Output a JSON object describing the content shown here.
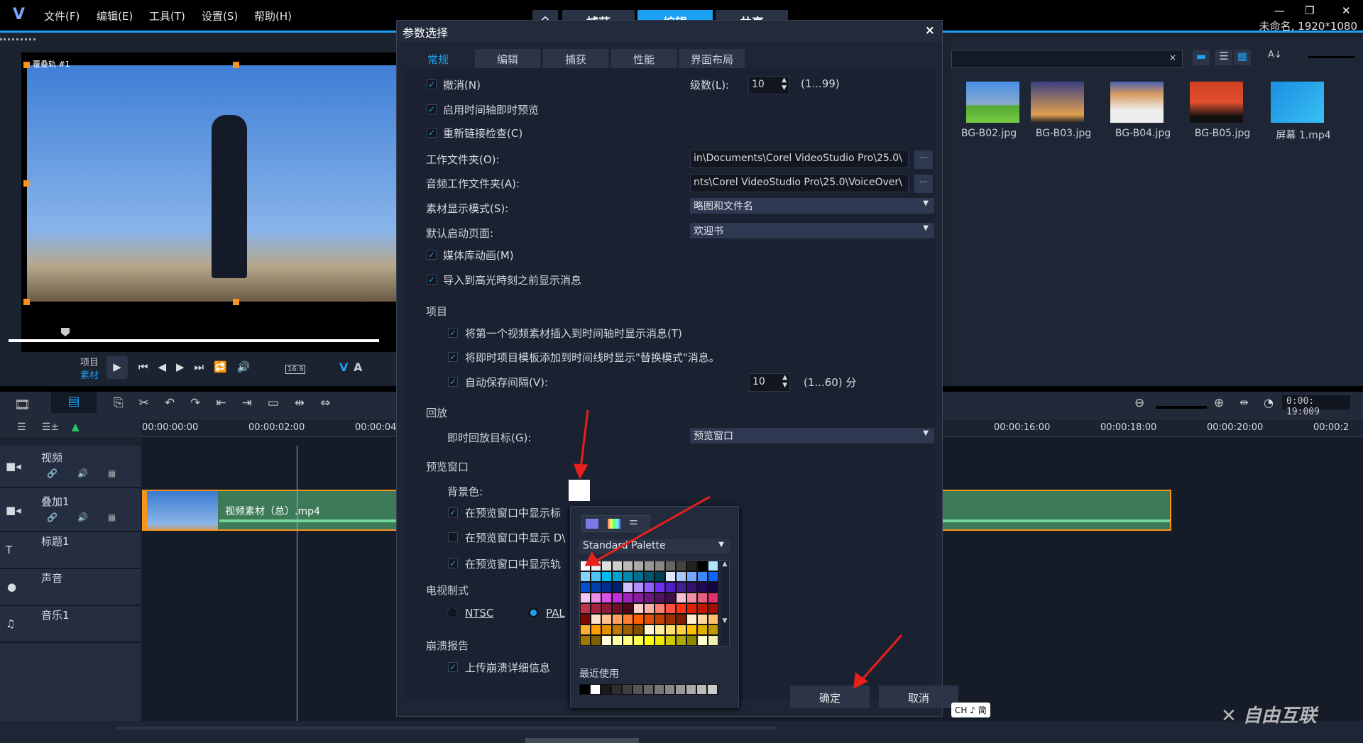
{
  "app": {
    "menus": [
      "文件(F)",
      "编辑(E)",
      "工具(T)",
      "设置(S)",
      "帮助(H)"
    ],
    "mode_tabs": [
      "捕获",
      "编辑",
      "共享"
    ],
    "active_mode": "编辑",
    "project_info": "未命名, 1920*1080"
  },
  "preview": {
    "track_label": "覆叠轨 #1",
    "mode_project": "项目",
    "mode_clip": "素材",
    "aspect": "16:9"
  },
  "library": {
    "items": [
      "BG-B02.jpg",
      "BG-B03.jpg",
      "BG-B04.jpg",
      "BG-B05.jpg",
      "屏幕 1.mp4"
    ]
  },
  "timeline": {
    "ruler": [
      "00:00:00:00",
      "00:00:02:00",
      "00:00:04:",
      "00:00:16:00",
      "00:00:18:00",
      "00:00:20:00",
      "00:00:2"
    ],
    "timecode": "0:00: 19:009",
    "tracks": [
      {
        "name": "视频",
        "icon": "video-camera-icon"
      },
      {
        "name": "叠加1",
        "icon": "overlay-icon"
      },
      {
        "name": "标题1",
        "icon": "title-icon"
      },
      {
        "name": "声音",
        "icon": "microphone-icon"
      },
      {
        "name": "音乐1",
        "icon": "music-icon"
      }
    ],
    "clip": {
      "name": "视频素材（总）.mp4",
      "color": "#3d7a57"
    }
  },
  "dialog": {
    "title": "参数选择",
    "close": "×",
    "tabs": [
      "常规",
      "编辑",
      "捕获",
      "性能",
      "界面布局"
    ],
    "active_tab": "常规",
    "undo": {
      "label": "撤消(N)",
      "checked": true,
      "levels_label": "级数(L):",
      "levels": "10",
      "range": "(1...99)"
    },
    "timeline_preview": {
      "label": "启用时间轴即时预览",
      "checked": true
    },
    "relink": {
      "label": "重新链接检查(C)",
      "checked": true
    },
    "work_folder": {
      "label": "工作文件夹(O):",
      "value": "in\\Documents\\Corel VideoStudio Pro\\25.0\\",
      "browse": "..."
    },
    "audio_folder": {
      "label": "音频工作文件夹(A):",
      "value": "nts\\Corel VideoStudio Pro\\25.0\\VoiceOver\\",
      "browse": "..."
    },
    "display_mode": {
      "label": "素材显示模式(S):",
      "value": "略图和文件名"
    },
    "startup_page": {
      "label": "默认启动页面:",
      "value": "欢迎书"
    },
    "library_anim": {
      "label": "媒体库动画(M)",
      "checked": true
    },
    "highlight_msg": {
      "label": "导入到高光時刻之前显示消息",
      "checked": true
    },
    "project_header": "项目",
    "first_clip_msg": {
      "label": "将第一个视频素材插入到时间轴时显示消息(T)",
      "checked": true
    },
    "template_msg": {
      "label": "将即时项目模板添加到时间线时显示\"替换模式\"消息。",
      "checked": true
    },
    "autosave": {
      "label": "自动保存间隔(V):",
      "checked": true,
      "value": "10",
      "range": "(1...60) 分"
    },
    "playback_header": "回放",
    "playback_target": {
      "label": "即时回放目标(G):",
      "value": "预览窗口"
    },
    "preview_header": "预览窗口",
    "bg_color": {
      "label": "背景色:",
      "color": "#ffffff"
    },
    "show_title": {
      "label": "在预览窗口中显示标",
      "checked": true
    },
    "show_dv": {
      "label": "在预览窗口中显示 D\\",
      "checked": false
    },
    "show_track": {
      "label": "在预览窗口中显示轨",
      "checked": true
    },
    "tv_header": "电视制式",
    "tv": {
      "options": [
        "NTSC",
        "PAL"
      ],
      "selected": "PAL"
    },
    "crash_header": "崩溃报告",
    "upload_crash": {
      "label": "上传崩溃详细信息",
      "checked": true
    },
    "ok": "确定",
    "cancel": "取消"
  },
  "color_picker": {
    "palette_name": "Standard Palette",
    "recent_label": "最近使用",
    "palette": [
      [
        "#ffffff",
        "#eeeeee",
        "#dddddd",
        "#cccccc",
        "#bbbbbb",
        "#aaaaaa",
        "#999999",
        "#888888",
        "#666666",
        "#444444",
        "#222222",
        "#000000",
        "#b3e5fc"
      ],
      [
        "#81d4fa",
        "#4fc3f7",
        "#00bcf0",
        "#00a2d0",
        "#0088b0",
        "#007090",
        "#005570",
        "#003f55",
        "#dde8ff",
        "#aac6ff",
        "#77a6ff",
        "#3f86ff",
        "#0a66ff"
      ],
      [
        "#0050d0",
        "#0040b0",
        "#003090",
        "#002070",
        "#d0c0ff",
        "#b090ff",
        "#9060ff",
        "#6a30ee",
        "#5020c0",
        "#402090",
        "#301070",
        "#200a55",
        "#150540"
      ],
      [
        "#f5c6f5",
        "#ea8ee8",
        "#dd50e8",
        "#c030e0",
        "#a020c0",
        "#8a1ca0",
        "#701880",
        "#551460",
        "#401048",
        "#f6c0d0",
        "#f090a8",
        "#e86080",
        "#e03070"
      ],
      [
        "#c03050",
        "#a82040",
        "#901838",
        "#701028",
        "#500818",
        "#ffd0d0",
        "#ffb0a8",
        "#ff8070",
        "#ff5040",
        "#ff3010",
        "#e02000",
        "#c01800",
        "#a01000"
      ],
      [
        "#800800",
        "#ffe0c8",
        "#ffc090",
        "#ffa060",
        "#ff8030",
        "#ff6000",
        "#e05000",
        "#c04000",
        "#a03000",
        "#802000",
        "#fff0d0",
        "#ffd8a0",
        "#ffc070"
      ],
      [
        "#ffb030",
        "#ffa000",
        "#e09000",
        "#c07800",
        "#a06000",
        "#805000",
        "#fff8d0",
        "#ffeea0",
        "#ffe070",
        "#ffd040",
        "#ffc000",
        "#e0b000",
        "#c09800"
      ],
      [
        "#a07800",
        "#806000",
        "#ffffe0",
        "#ffffa8",
        "#ffff80",
        "#ffff50",
        "#ffff00",
        "#f0e800",
        "#d0c800",
        "#b0a800",
        "#908800",
        "#ffffd0",
        "#f0f0b0"
      ]
    ],
    "recent": [
      "#000000",
      "#ffffff",
      "#1a1a1a",
      "#2e2e2e",
      "#404040",
      "#555555",
      "#666666",
      "#777777",
      "#888888",
      "#999999",
      "#aaaaaa",
      "#bbbbbb",
      "#cccccc"
    ]
  },
  "ime": "CH ♪ 简"
}
